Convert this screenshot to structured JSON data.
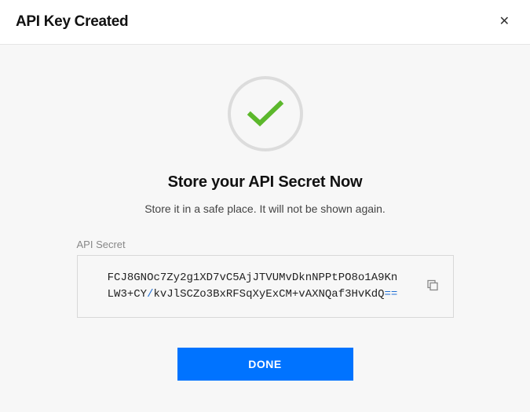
{
  "header": {
    "title": "API Key Created",
    "close_icon": "✕"
  },
  "content": {
    "heading": "Store your API Secret Now",
    "subheading": "Store it in a safe place. It will not be shown again.",
    "secret_label": "API Secret",
    "secret_line1_a": "FCJ8GNOc7Zy2g1XD7vC5AjJTVUMvDknNPPtPO8o1A9Kn",
    "secret_line2_a": "LW3+CY",
    "secret_line2_b": "/",
    "secret_line2_c": "kvJlSCZo3BxRFSqXyExCM+vAXNQaf3HvKdQ",
    "secret_line2_d": "==",
    "done_label": "DONE"
  },
  "colors": {
    "primary": "#0073ff",
    "success_check": "#5cb82c"
  }
}
